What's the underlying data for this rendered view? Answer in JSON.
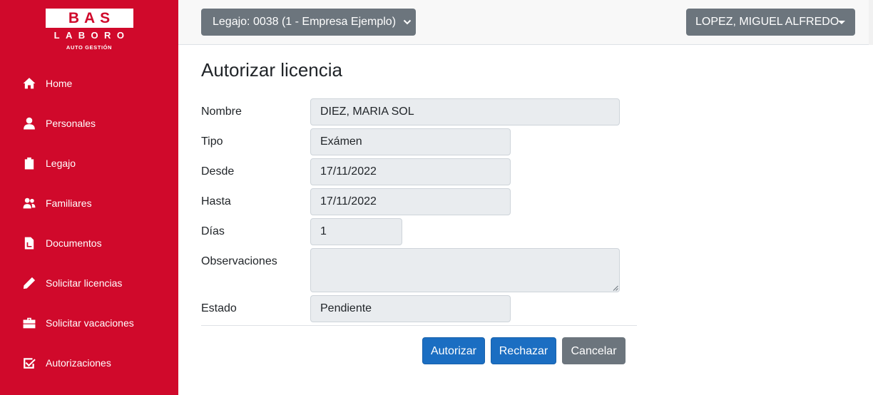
{
  "logo": {
    "line1": "BAS",
    "line2": "LABORO",
    "line3": "AUTO GESTIÓN"
  },
  "sidebar": {
    "items": [
      {
        "label": "Home",
        "icon": "home-icon"
      },
      {
        "label": "Personales",
        "icon": "user-icon"
      },
      {
        "label": "Legajo",
        "icon": "clipboard-icon"
      },
      {
        "label": "Familiares",
        "icon": "users-icon"
      },
      {
        "label": "Documentos",
        "icon": "document-icon"
      },
      {
        "label": "Solicitar licencias",
        "icon": "pencil-icon"
      },
      {
        "label": "Solicitar vacaciones",
        "icon": "briefcase-icon"
      },
      {
        "label": "Autorizaciones",
        "icon": "check-square-icon"
      }
    ]
  },
  "header": {
    "legajo_select": "Legajo: 0038 (1 - Empresa Ejemplo)",
    "user_menu": "LOPEZ, MIGUEL ALFREDO"
  },
  "main": {
    "title": "Autorizar licencia",
    "fields": {
      "nombre": {
        "label": "Nombre",
        "value": "DIEZ, MARIA SOL"
      },
      "tipo": {
        "label": "Tipo",
        "value": "Exámen"
      },
      "desde": {
        "label": "Desde",
        "value": "17/11/2022"
      },
      "hasta": {
        "label": "Hasta",
        "value": "17/11/2022"
      },
      "dias": {
        "label": "Días",
        "value": "1"
      },
      "observaciones": {
        "label": "Observaciones",
        "value": ""
      },
      "estado": {
        "label": "Estado",
        "value": "Pendiente"
      }
    },
    "buttons": {
      "autorizar": "Autorizar",
      "rechazar": "Rechazar",
      "cancelar": "Cancelar"
    }
  },
  "colors": {
    "brand": "#d0092b",
    "primary": "#1b6ec2",
    "secondary": "#6c757d",
    "field_bg": "#e9ecef"
  }
}
